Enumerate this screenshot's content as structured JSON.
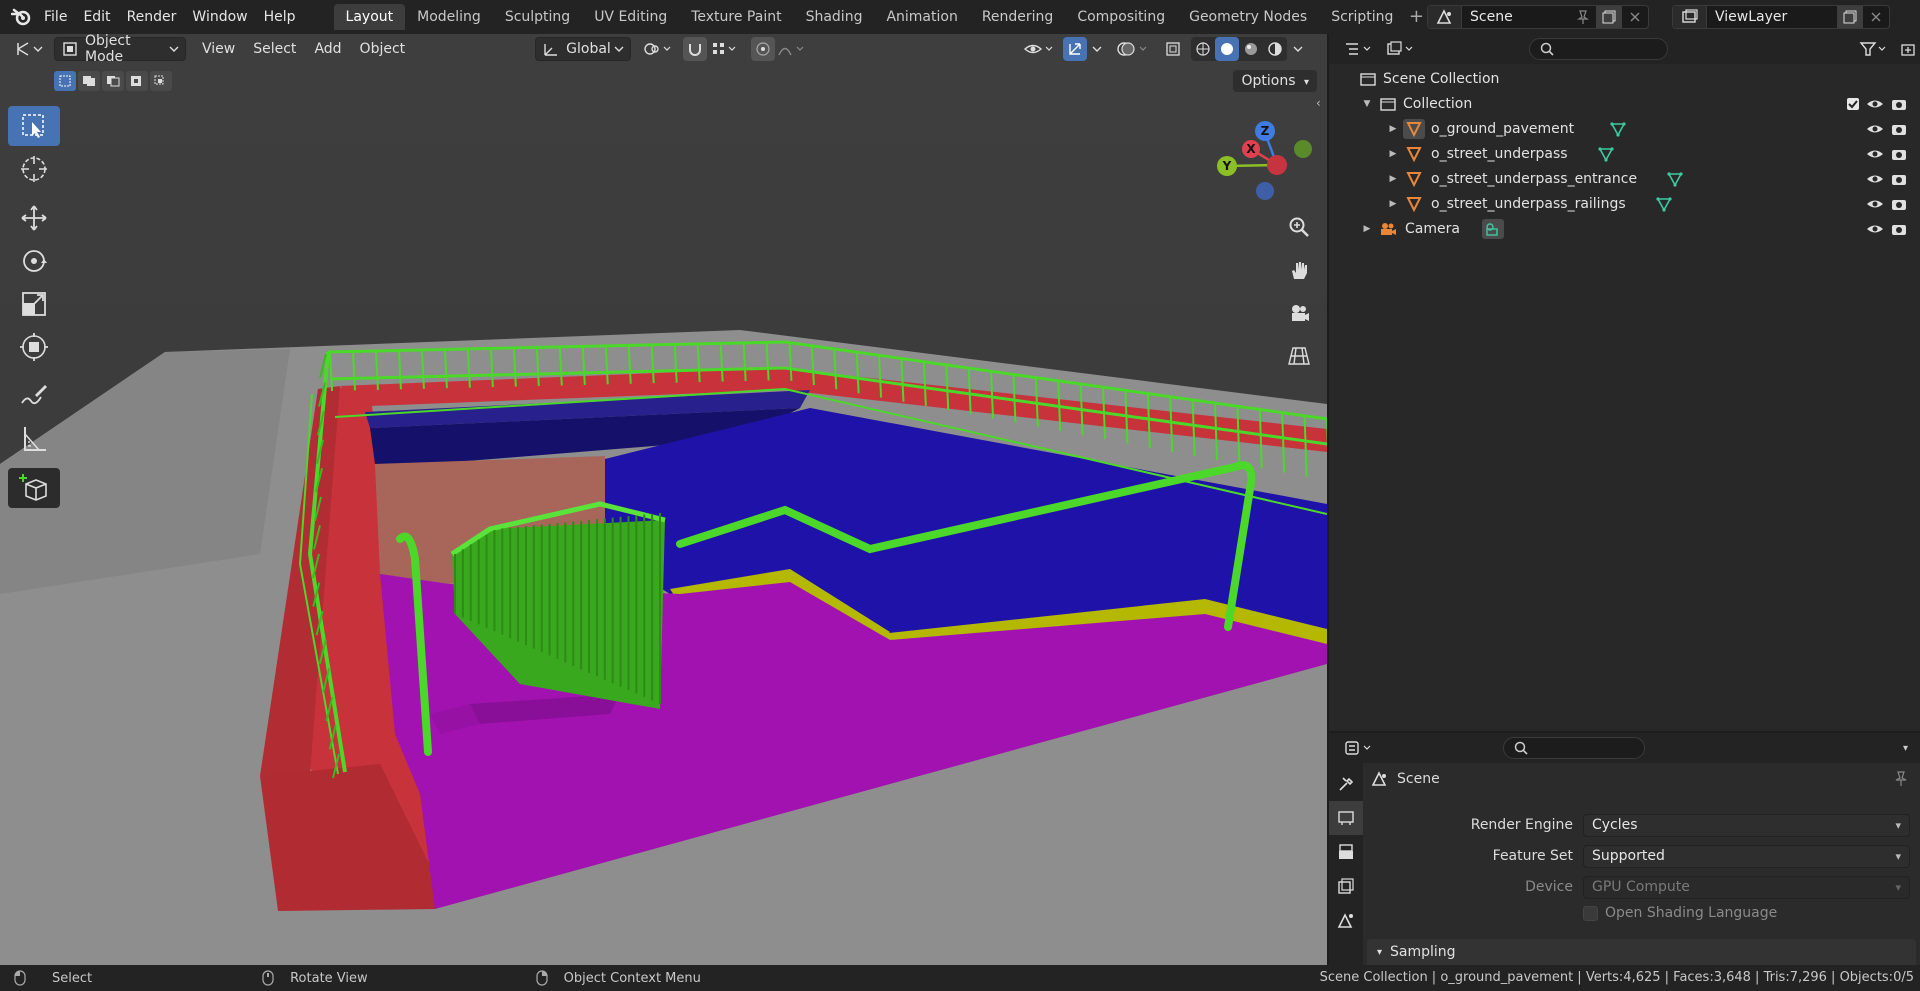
{
  "menu": {
    "items": [
      "File",
      "Edit",
      "Render",
      "Window",
      "Help"
    ]
  },
  "workspaces": {
    "tabs": [
      "Layout",
      "Modeling",
      "Sculpting",
      "UV Editing",
      "Texture Paint",
      "Shading",
      "Animation",
      "Rendering",
      "Compositing",
      "Geometry Nodes",
      "Scripting"
    ],
    "active": "Layout"
  },
  "scene_selector": {
    "name": "Scene"
  },
  "viewlayer_selector": {
    "name": "ViewLayer"
  },
  "viewport_header": {
    "mode": "Object Mode",
    "menus": [
      "View",
      "Select",
      "Add",
      "Object"
    ],
    "transform_orientation": "Global",
    "options_label": "Options"
  },
  "gizmo": {
    "x": "X",
    "y": "Y",
    "z": "Z"
  },
  "outliner": {
    "root": "Scene Collection",
    "collection": "Collection",
    "objects": [
      "o_ground_pavement",
      "o_street_underpass",
      "o_street_underpass_entrance",
      "o_street_underpass_railings"
    ],
    "camera": "Camera"
  },
  "properties": {
    "context": "Scene",
    "render_engine_label": "Render Engine",
    "render_engine": "Cycles",
    "feature_set_label": "Feature Set",
    "feature_set": "Supported",
    "device_label": "Device",
    "device": "GPU Compute",
    "osl_label": "Open Shading Language",
    "sampling_label": "Sampling"
  },
  "statusbar": {
    "select": "Select",
    "rotate": "Rotate View",
    "context_menu": "Object Context Menu",
    "stats": "Scene Collection | o_ground_pavement | Verts:4,625 | Faces:3,648 | Tris:7,296 | Objects:0/5"
  },
  "colors": {
    "accent": "#4772b3",
    "railing": "#4cd82a",
    "wall_red": "#c8323a",
    "floor_magenta": "#a212b0",
    "wall_blue": "#1f12a8",
    "step_yellow": "#b4b800",
    "ground": "#8e8e8e"
  }
}
